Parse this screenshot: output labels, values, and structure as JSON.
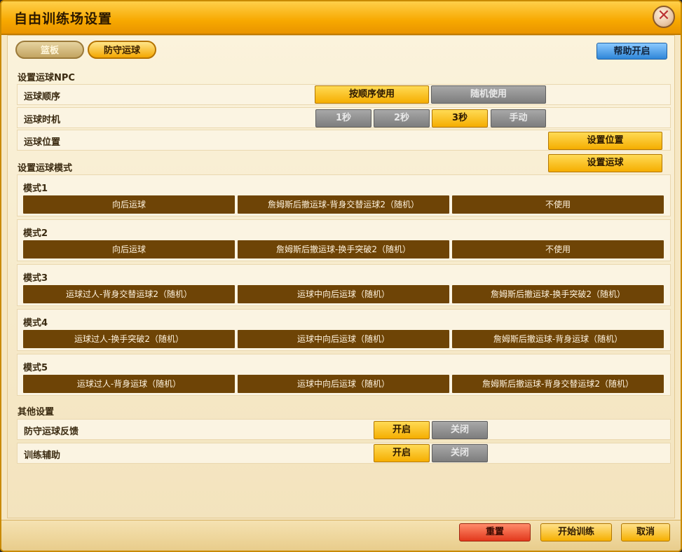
{
  "window": {
    "title": "自由训练场设置"
  },
  "tabs": [
    {
      "label": "篮板",
      "state": "inactive"
    },
    {
      "label": "防守运球",
      "state": "active"
    }
  ],
  "help_button": "帮助开启",
  "npc_section": {
    "title": "设置运球NPC",
    "order": {
      "label": "运球顺序",
      "options": [
        "按顺序使用",
        "随机使用"
      ],
      "selected": "按顺序使用"
    },
    "timing": {
      "label": "运球时机",
      "options": [
        "1秒",
        "2秒",
        "3秒",
        "手动"
      ],
      "selected": "3秒"
    },
    "position": {
      "label": "运球位置",
      "button": "设置位置"
    }
  },
  "mode_section": {
    "title": "设置运球模式",
    "set_button": "设置运球",
    "modes": [
      {
        "label": "模式1",
        "cells": [
          "向后运球",
          "詹姆斯后撤运球-背身交替运球2（随机）",
          "不使用"
        ]
      },
      {
        "label": "模式2",
        "cells": [
          "向后运球",
          "詹姆斯后撤运球-换手突破2（随机）",
          "不使用"
        ]
      },
      {
        "label": "模式3",
        "cells": [
          "运球过人-背身交替运球2（随机）",
          "运球中向后运球（随机）",
          "詹姆斯后撤运球-换手突破2（随机）"
        ]
      },
      {
        "label": "模式4",
        "cells": [
          "运球过人-换手突破2（随机）",
          "运球中向后运球（随机）",
          "詹姆斯后撤运球-背身运球（随机）"
        ]
      },
      {
        "label": "模式5",
        "cells": [
          "运球过人-背身运球（随机）",
          "运球中向后运球（随机）",
          "詹姆斯后撤运球-背身交替运球2（随机）"
        ]
      }
    ]
  },
  "other_section": {
    "title": "其他设置",
    "feedback": {
      "label": "防守运球反馈",
      "on": "开启",
      "off": "关闭",
      "selected": "开启"
    },
    "assist": {
      "label": "训练辅助",
      "on": "开启",
      "off": "关闭",
      "selected": "开启"
    }
  },
  "footer": {
    "reset": "重置",
    "start": "开始训练",
    "cancel": "取消"
  }
}
